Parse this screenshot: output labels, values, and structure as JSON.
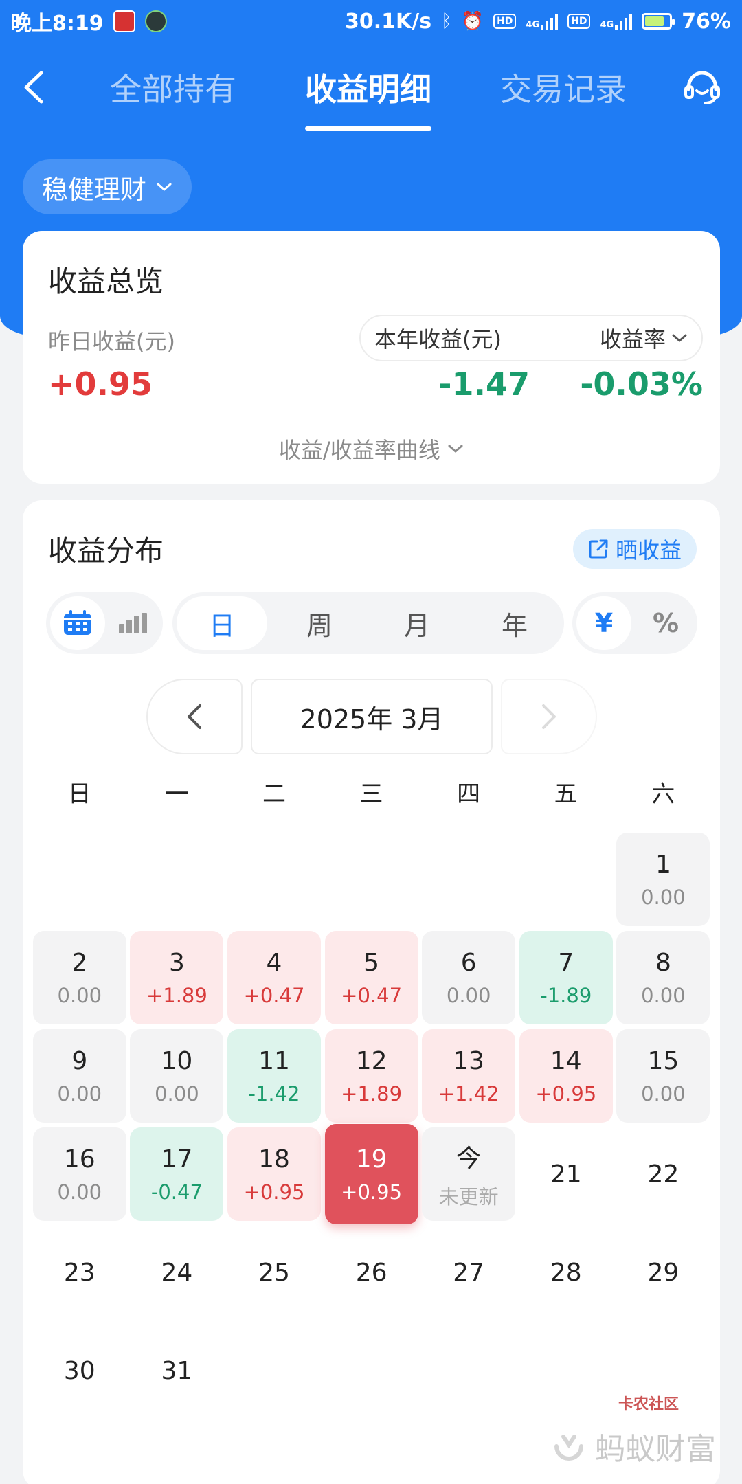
{
  "status_bar": {
    "time": "晚上8:19",
    "net_speed": "30.1K/s",
    "hd1": "HD",
    "hd2": "HD",
    "net1": "4G",
    "net2": "4G",
    "battery": "76%"
  },
  "nav": {
    "tabs": [
      {
        "label": "全部持有",
        "active": false
      },
      {
        "label": "收益明细",
        "active": true
      },
      {
        "label": "交易记录",
        "active": false
      }
    ]
  },
  "fund_selector": {
    "label": "稳健理财"
  },
  "overview": {
    "title": "收益总览",
    "yesterday_label": "昨日收益(元)",
    "yesterday_value": "+0.95",
    "year_label": "本年收益(元)",
    "rate_label": "收益率",
    "year_value": "-1.47",
    "rate_value": "-0.03%",
    "curve_toggle": "收益/收益率曲线"
  },
  "distribution": {
    "title": "收益分布",
    "share_label": "晒收益",
    "periods": [
      "日",
      "周",
      "月",
      "年"
    ],
    "active_period": "日",
    "units": [
      "¥",
      "%"
    ],
    "active_unit": "¥",
    "month_label": "2025年 3月",
    "weekdays": [
      "日",
      "一",
      "二",
      "三",
      "四",
      "五",
      "六"
    ]
  },
  "calendar": {
    "first_weekday": 6,
    "days": [
      {
        "d": "1",
        "v": "0.00",
        "type": "zero"
      },
      {
        "d": "2",
        "v": "0.00",
        "type": "zero"
      },
      {
        "d": "3",
        "v": "+1.89",
        "type": "pos"
      },
      {
        "d": "4",
        "v": "+0.47",
        "type": "pos"
      },
      {
        "d": "5",
        "v": "+0.47",
        "type": "pos"
      },
      {
        "d": "6",
        "v": "0.00",
        "type": "zero"
      },
      {
        "d": "7",
        "v": "-1.89",
        "type": "neg"
      },
      {
        "d": "8",
        "v": "0.00",
        "type": "zero"
      },
      {
        "d": "9",
        "v": "0.00",
        "type": "zero"
      },
      {
        "d": "10",
        "v": "0.00",
        "type": "zero"
      },
      {
        "d": "11",
        "v": "-1.42",
        "type": "neg"
      },
      {
        "d": "12",
        "v": "+1.89",
        "type": "pos"
      },
      {
        "d": "13",
        "v": "+1.42",
        "type": "pos"
      },
      {
        "d": "14",
        "v": "+0.95",
        "type": "pos"
      },
      {
        "d": "15",
        "v": "0.00",
        "type": "zero"
      },
      {
        "d": "16",
        "v": "0.00",
        "type": "zero"
      },
      {
        "d": "17",
        "v": "-0.47",
        "type": "neg"
      },
      {
        "d": "18",
        "v": "+0.95",
        "type": "pos"
      },
      {
        "d": "19",
        "v": "+0.95",
        "type": "sel"
      },
      {
        "d": "今",
        "v": "未更新",
        "type": "today"
      },
      {
        "d": "21",
        "v": "",
        "type": "plain"
      },
      {
        "d": "22",
        "v": "",
        "type": "plain"
      },
      {
        "d": "23",
        "v": "",
        "type": "plain"
      },
      {
        "d": "24",
        "v": "",
        "type": "plain"
      },
      {
        "d": "25",
        "v": "",
        "type": "plain"
      },
      {
        "d": "26",
        "v": "",
        "type": "plain"
      },
      {
        "d": "27",
        "v": "",
        "type": "plain"
      },
      {
        "d": "28",
        "v": "",
        "type": "plain"
      },
      {
        "d": "29",
        "v": "",
        "type": "plain"
      },
      {
        "d": "30",
        "v": "",
        "type": "plain"
      },
      {
        "d": "31",
        "v": "",
        "type": "plain"
      }
    ]
  },
  "watermark": {
    "text": "蚂蚁财富",
    "logo_text": "卡农社区"
  },
  "colors": {
    "brand_blue": "#1f7cf4",
    "gain_red": "#e23b3b",
    "loss_green": "#1a9c6c"
  }
}
